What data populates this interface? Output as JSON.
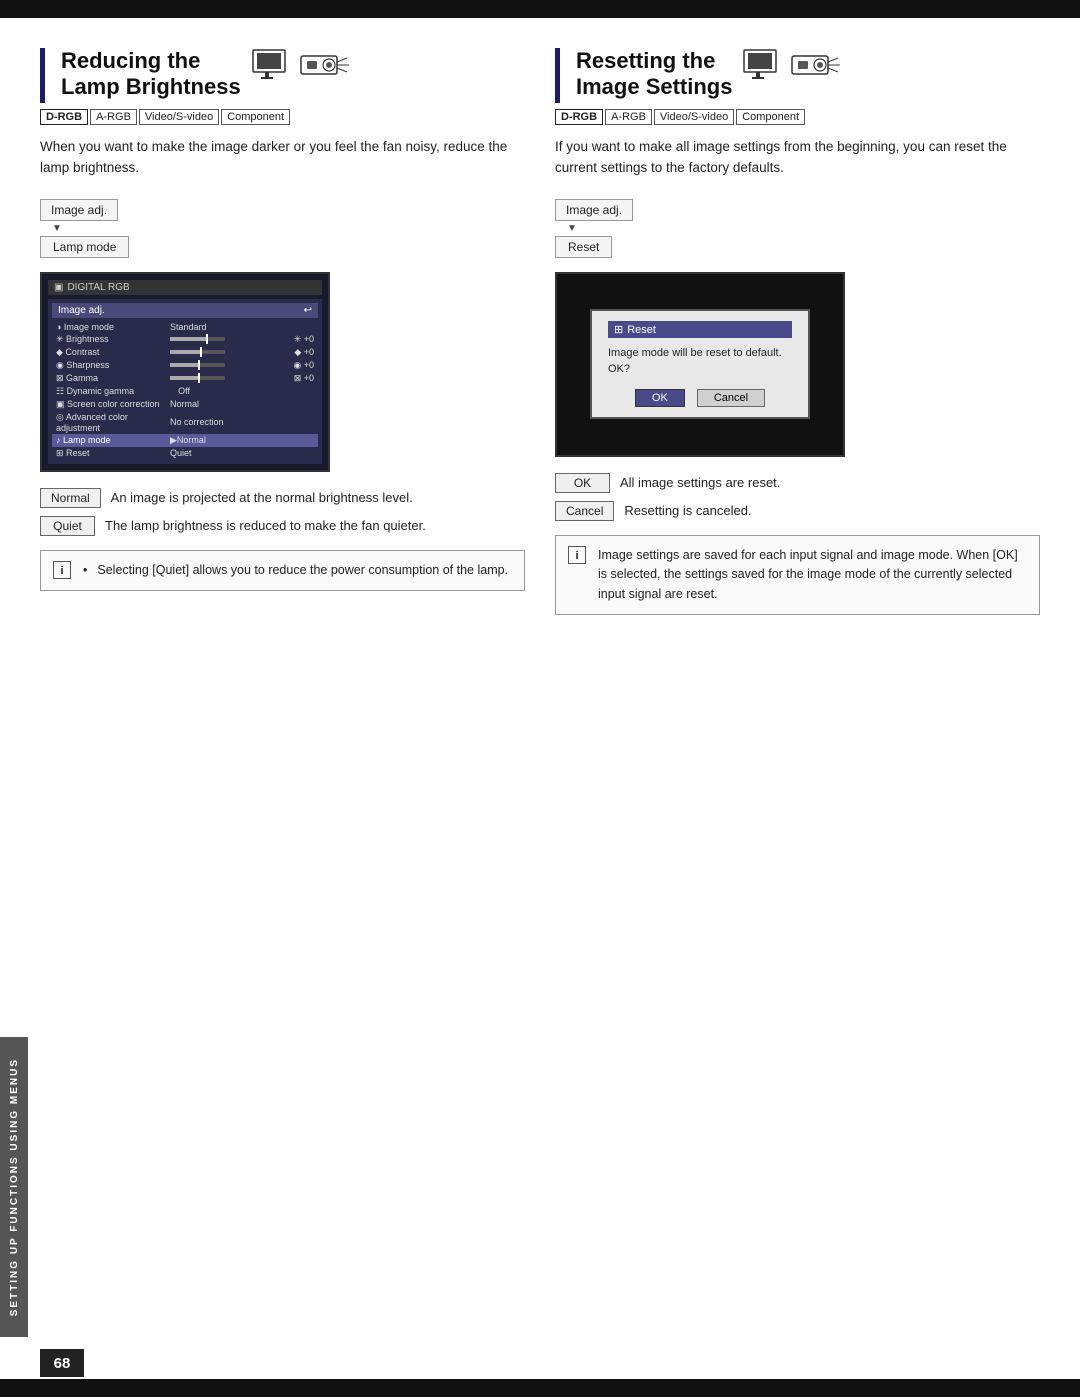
{
  "page": {
    "number": "68",
    "sidebar_label": "SETTING UP FUNCTIONS USING MENUS"
  },
  "left_section": {
    "title_line1": "Reducing the",
    "title_line2": "Lamp Brightness",
    "badges": [
      "D-RGB",
      "A-RGB",
      "Video/S-video",
      "Component"
    ],
    "description": "When you want to make the image darker or you feel the fan noisy, reduce the lamp brightness.",
    "menu_path": {
      "step1": "Image adj.",
      "arrow": "▼",
      "step2": "Lamp mode"
    },
    "screen": {
      "title_bar": "DIGITAL RGB",
      "menu_header": "Image adj.",
      "menu_back": "↩",
      "rows": [
        {
          "icon": "◑",
          "label": "Image mode",
          "value": "Standard",
          "type": "text"
        },
        {
          "icon": "✳",
          "label": "Brightness",
          "value": "+0",
          "type": "bar",
          "fill": 70
        },
        {
          "icon": "◆",
          "label": "Contrast",
          "value": "+0",
          "type": "bar",
          "fill": 55
        },
        {
          "icon": "◉",
          "label": "Sharpness",
          "value": "+0",
          "type": "bar",
          "fill": 50
        },
        {
          "icon": "⊠",
          "label": "Gamma",
          "value": "+0",
          "type": "bar",
          "fill": 50
        },
        {
          "icon": "☷",
          "label": "Dynamic gamma",
          "value": "Off",
          "type": "text"
        },
        {
          "icon": "▣",
          "label": "Screen color correction",
          "value": "Normal",
          "type": "text"
        },
        {
          "icon": "◎",
          "label": "Advanced color adjustment",
          "value": "No correction",
          "type": "text"
        },
        {
          "icon": "♪",
          "label": "Lamp mode",
          "value": "▶Normal",
          "type": "text",
          "selected": true
        },
        {
          "icon": "⊞",
          "label": "Reset",
          "value": "Quiet",
          "type": "text"
        }
      ]
    },
    "buttons": [
      {
        "label": "Normal",
        "description": "An image is projected at the normal brightness level."
      },
      {
        "label": "Quiet",
        "description": "The lamp brightness is reduced to make the fan quieter."
      }
    ],
    "note": {
      "icon": "i",
      "bullet": "•",
      "text": "Selecting [Quiet] allows you to reduce the power consumption of the lamp."
    }
  },
  "right_section": {
    "title_line1": "Resetting the",
    "title_line2": "Image Settings",
    "badges": [
      "D-RGB",
      "A-RGB",
      "Video/S-video",
      "Component"
    ],
    "description": "If you want to make all image settings from the beginning, you can reset the current settings to the factory defaults.",
    "menu_path": {
      "step1": "Image adj.",
      "arrow": "▼",
      "step2": "Reset"
    },
    "dialog": {
      "title_icon": "⊞",
      "title_text": "Reset",
      "body": "Image mode will be reset to default. OK?",
      "ok_label": "OK",
      "cancel_label": "Cancel"
    },
    "buttons": [
      {
        "label": "OK",
        "description": "All image settings are reset."
      },
      {
        "label": "Cancel",
        "description": "Resetting is canceled."
      }
    ],
    "note": {
      "icon": "i",
      "text": "Image settings are saved for each input signal and image mode. When [OK] is selected, the settings saved for the image mode of the currently selected input signal are reset."
    }
  }
}
